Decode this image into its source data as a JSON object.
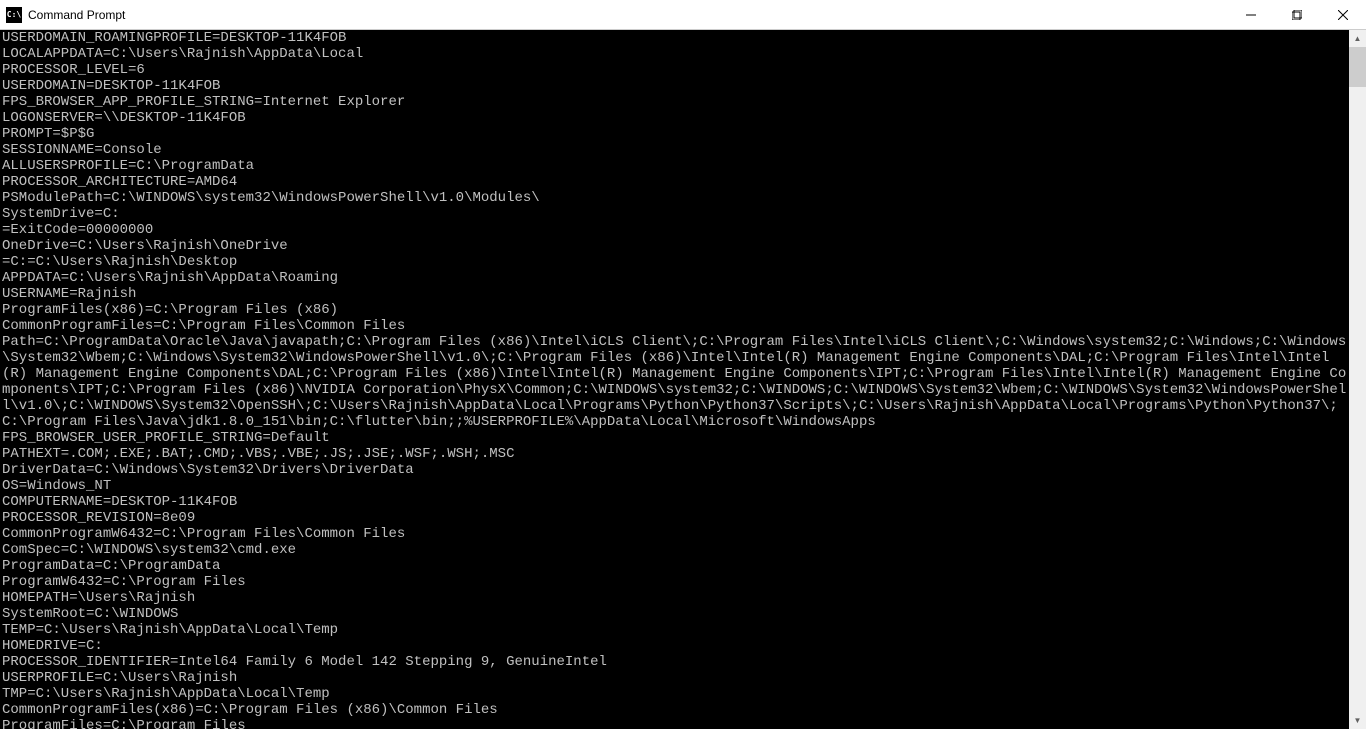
{
  "window": {
    "title": "Command Prompt",
    "icon_label": "C:\\"
  },
  "terminal": {
    "lines": [
      "USERDOMAIN_ROAMINGPROFILE=DESKTOP-11K4FOB",
      "LOCALAPPDATA=C:\\Users\\Rajnish\\AppData\\Local",
      "PROCESSOR_LEVEL=6",
      "USERDOMAIN=DESKTOP-11K4FOB",
      "FPS_BROWSER_APP_PROFILE_STRING=Internet Explorer",
      "LOGONSERVER=\\\\DESKTOP-11K4FOB",
      "PROMPT=$P$G",
      "SESSIONNAME=Console",
      "ALLUSERSPROFILE=C:\\ProgramData",
      "PROCESSOR_ARCHITECTURE=AMD64",
      "PSModulePath=C:\\WINDOWS\\system32\\WindowsPowerShell\\v1.0\\Modules\\",
      "SystemDrive=C:",
      "=ExitCode=00000000",
      "OneDrive=C:\\Users\\Rajnish\\OneDrive",
      "=C:=C:\\Users\\Rajnish\\Desktop",
      "APPDATA=C:\\Users\\Rajnish\\AppData\\Roaming",
      "USERNAME=Rajnish",
      "ProgramFiles(x86)=C:\\Program Files (x86)",
      "CommonProgramFiles=C:\\Program Files\\Common Files",
      "Path=C:\\ProgramData\\Oracle\\Java\\javapath;C:\\Program Files (x86)\\Intel\\iCLS Client\\;C:\\Program Files\\Intel\\iCLS Client\\;C:\\Windows\\system32;C:\\Windows;C:\\Windows\\System32\\Wbem;C:\\Windows\\System32\\WindowsPowerShell\\v1.0\\;C:\\Program Files (x86)\\Intel\\Intel(R) Management Engine Components\\DAL;C:\\Program Files\\Intel\\Intel(R) Management Engine Components\\DAL;C:\\Program Files (x86)\\Intel\\Intel(R) Management Engine Components\\IPT;C:\\Program Files\\Intel\\Intel(R) Management Engine Components\\IPT;C:\\Program Files (x86)\\NVIDIA Corporation\\PhysX\\Common;C:\\WINDOWS\\system32;C:\\WINDOWS;C:\\WINDOWS\\System32\\Wbem;C:\\WINDOWS\\System32\\WindowsPowerShell\\v1.0\\;C:\\WINDOWS\\System32\\OpenSSH\\;C:\\Users\\Rajnish\\AppData\\Local\\Programs\\Python\\Python37\\Scripts\\;C:\\Users\\Rajnish\\AppData\\Local\\Programs\\Python\\Python37\\;C:\\Program Files\\Java\\jdk1.8.0_151\\bin;C:\\flutter\\bin;;%USERPROFILE%\\AppData\\Local\\Microsoft\\WindowsApps",
      "FPS_BROWSER_USER_PROFILE_STRING=Default",
      "PATHEXT=.COM;.EXE;.BAT;.CMD;.VBS;.VBE;.JS;.JSE;.WSF;.WSH;.MSC",
      "DriverData=C:\\Windows\\System32\\Drivers\\DriverData",
      "OS=Windows_NT",
      "COMPUTERNAME=DESKTOP-11K4FOB",
      "PROCESSOR_REVISION=8e09",
      "CommonProgramW6432=C:\\Program Files\\Common Files",
      "ComSpec=C:\\WINDOWS\\system32\\cmd.exe",
      "ProgramData=C:\\ProgramData",
      "ProgramW6432=C:\\Program Files",
      "HOMEPATH=\\Users\\Rajnish",
      "SystemRoot=C:\\WINDOWS",
      "TEMP=C:\\Users\\Rajnish\\AppData\\Local\\Temp",
      "HOMEDRIVE=C:",
      "PROCESSOR_IDENTIFIER=Intel64 Family 6 Model 142 Stepping 9, GenuineIntel",
      "USERPROFILE=C:\\Users\\Rajnish",
      "TMP=C:\\Users\\Rajnish\\AppData\\Local\\Temp",
      "CommonProgramFiles(x86)=C:\\Program Files (x86)\\Common Files",
      "ProgramFiles=C:\\Program Files"
    ]
  }
}
